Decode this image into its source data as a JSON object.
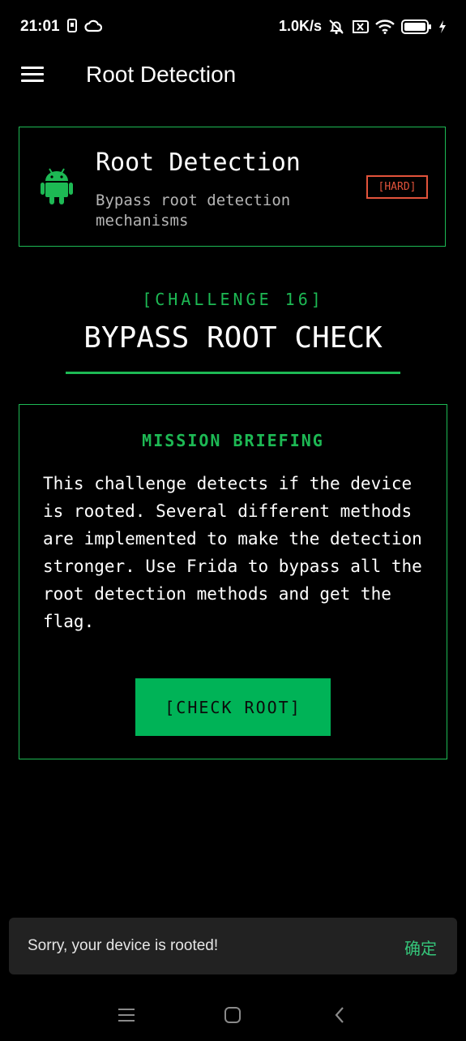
{
  "status_bar": {
    "time": "21:01",
    "net_speed": "1.0K/s",
    "icons": [
      "sim-icon",
      "cloud-icon",
      "mute-icon",
      "sim-x-icon",
      "wifi-icon",
      "battery-icon",
      "charging-icon"
    ]
  },
  "app_bar": {
    "title": "Root Detection",
    "menu_icon": "hamburger-menu-icon"
  },
  "header_card": {
    "icon": "android-icon",
    "title": "Root Detection",
    "subtitle": "Bypass root detection mechanisms",
    "difficulty": "[HARD]"
  },
  "challenge": {
    "tag": "[CHALLENGE 16]",
    "title": "BYPASS ROOT CHECK"
  },
  "briefing": {
    "label": "MISSION BRIEFING",
    "text": "This challenge detects if the device is rooted. Several different methods are implemented to make the detection stronger. Use Frida to bypass all the root detection methods and get the flag.",
    "button_label": "[CHECK ROOT]"
  },
  "snackbar": {
    "message": "Sorry, your device is rooted!",
    "action": "确定"
  },
  "nav_bar": {
    "icons": [
      "recents-icon",
      "home-icon",
      "back-icon"
    ]
  },
  "colors": {
    "background": "#000000",
    "accent_green": "#1db954",
    "button_green": "#00b357",
    "hard_red": "#e2533b",
    "snackbar_bg": "#222222",
    "snackbar_action": "#35c57a"
  }
}
